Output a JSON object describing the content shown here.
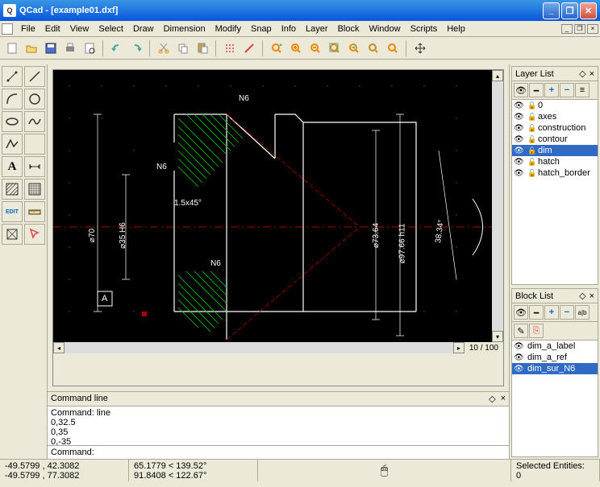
{
  "window": {
    "title": "QCad - [example01.dxf]"
  },
  "menus": [
    "File",
    "Edit",
    "View",
    "Select",
    "Draw",
    "Dimension",
    "Modify",
    "Snap",
    "Info",
    "Layer",
    "Block",
    "Window",
    "Scripts",
    "Help"
  ],
  "zoom": "10 / 100",
  "layer_panel": {
    "title": "Layer List",
    "items": [
      {
        "name": "0",
        "visible": true,
        "locked": false,
        "selected": false
      },
      {
        "name": "axes",
        "visible": true,
        "locked": false,
        "selected": false
      },
      {
        "name": "construction",
        "visible": true,
        "locked": false,
        "selected": false
      },
      {
        "name": "contour",
        "visible": true,
        "locked": false,
        "selected": false
      },
      {
        "name": "dim",
        "visible": true,
        "locked": false,
        "selected": true
      },
      {
        "name": "hatch",
        "visible": true,
        "locked": false,
        "selected": false
      },
      {
        "name": "hatch_border",
        "visible": true,
        "locked": false,
        "selected": false
      }
    ]
  },
  "block_panel": {
    "title": "Block List",
    "items": [
      {
        "name": "dim_a_label",
        "visible": true,
        "selected": false
      },
      {
        "name": "dim_a_ref",
        "visible": true,
        "selected": false
      },
      {
        "name": "dim_sur_N6",
        "visible": true,
        "selected": true
      }
    ]
  },
  "command": {
    "title": "Command line",
    "history": [
      "Command: line",
      "0,32.5",
      "0,35",
      "0,-35"
    ],
    "prompt": "Command:",
    "value": ""
  },
  "status": {
    "coords_abs": "-49.5799 , 42.3082",
    "coords_rel": "-49.5799 , 77.3082",
    "polar1": "65.1779 < 139.52°",
    "polar2": "91.8408 < 122.67°",
    "selected_label": "Selected Entities:",
    "selected_count": "0"
  },
  "drawing_labels": {
    "d70": "⌀70",
    "d35": "⌀35  H6",
    "d7364": "⌀73.64",
    "d9766": "⌀97.66 h11",
    "a3834": "38.34°",
    "chamfer": "1.5x45°",
    "n6_top": "N6",
    "n6_mid": "N6",
    "n6_bot": "N6",
    "a_label": "A"
  },
  "edit_label": "EDIT"
}
